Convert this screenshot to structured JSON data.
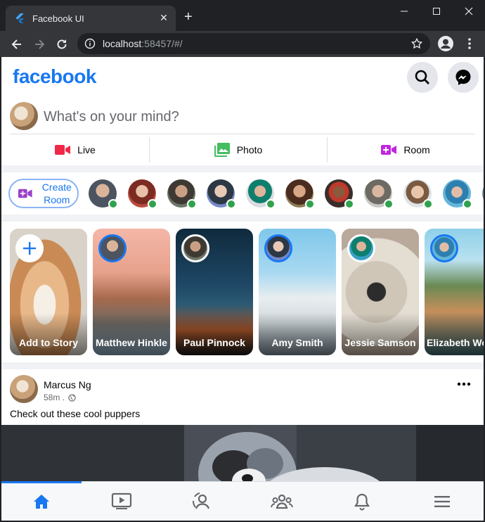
{
  "browser": {
    "tab_title": "Facebook UI",
    "tab_close": "✕",
    "new_tab": "+",
    "url_host": "localhost",
    "url_rest": ":58457/#/"
  },
  "header": {
    "logo": "facebook",
    "brand_color": "#1877f2"
  },
  "composer": {
    "placeholder": "What's on your mind?",
    "actions": [
      {
        "label": "Live",
        "icon": "video-camera-icon",
        "color": "#f02849"
      },
      {
        "label": "Photo",
        "icon": "photo-library-icon",
        "color": "#45bd62"
      },
      {
        "label": "Room",
        "icon": "video-call-icon",
        "color": "#c027e0"
      }
    ]
  },
  "rooms": {
    "create_label": "Create Room",
    "online_color": "#31a24c"
  },
  "stories": {
    "add_label": "Add to Story",
    "items": [
      {
        "name": "Matthew Hinkle"
      },
      {
        "name": "Paul Pinnock"
      },
      {
        "name": "Amy Smith"
      },
      {
        "name": "Jessie Samson"
      },
      {
        "name": "Elizabeth Wong"
      }
    ]
  },
  "post": {
    "author": "Marcus Ng",
    "time": "58m .",
    "caption": "Check out these cool puppers"
  },
  "bottom_nav": {
    "items": [
      "home-icon",
      "video-icon",
      "profile-icon",
      "groups-icon",
      "notifications-icon",
      "menu-icon"
    ],
    "active": "home-icon"
  }
}
